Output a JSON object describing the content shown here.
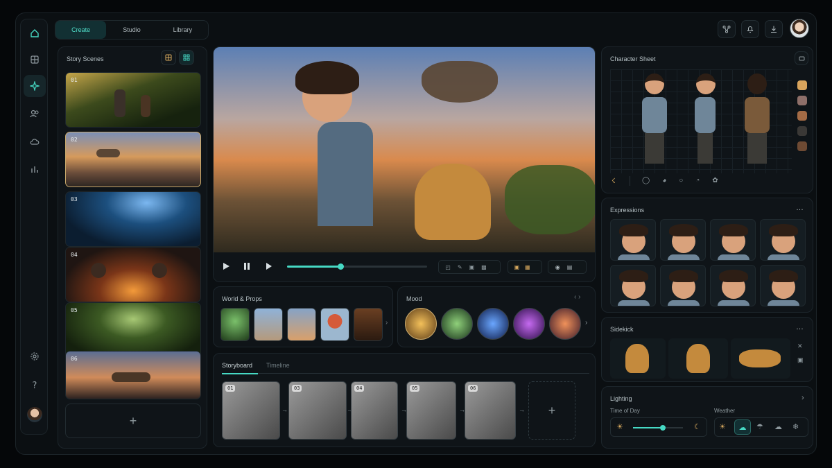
{
  "nav": {
    "tabs": [
      {
        "label": "Create",
        "active": true
      },
      {
        "label": "Studio",
        "active": false
      },
      {
        "label": "Library",
        "active": false
      }
    ],
    "rail_icons": [
      "home-icon",
      "layout-icon",
      "sparkle-icon",
      "users-icon",
      "cloud-icon",
      "chart-icon"
    ],
    "rail_bottom_icons": [
      "settings-icon",
      "help-icon",
      "avatar"
    ],
    "header_icons": [
      "share-icon",
      "bell-icon",
      "download-icon",
      "avatar"
    ]
  },
  "scenes": {
    "title": "Story Scenes",
    "items": [
      {
        "num": "01"
      },
      {
        "num": "02"
      },
      {
        "num": "03"
      },
      {
        "num": "04"
      },
      {
        "num": "05"
      },
      {
        "num": "06"
      }
    ],
    "selected": "02",
    "add_label": "+"
  },
  "player": {
    "progress": 0.38
  },
  "world": {
    "title": "World & Props",
    "items": [
      "forest",
      "castle",
      "airship",
      "balloon",
      "library"
    ]
  },
  "mood": {
    "title": "Mood",
    "items": [
      "golden",
      "green",
      "blue",
      "violet",
      "sunset"
    ]
  },
  "storyboard": {
    "tabs": [
      {
        "label": "Storyboard",
        "active": true
      },
      {
        "label": "Timeline",
        "active": false
      }
    ],
    "frames": [
      {
        "num": "01"
      },
      {
        "num": "03"
      },
      {
        "num": "04"
      },
      {
        "num": "05"
      },
      {
        "num": "06"
      }
    ],
    "add_label": "+"
  },
  "character": {
    "title": "Character Sheet",
    "views": [
      "front",
      "side",
      "back"
    ],
    "swatches": [
      "#d9a45c",
      "#8e6f69",
      "#a46b45",
      "#3a3836",
      "#6e4a33"
    ]
  },
  "expressions": {
    "title": "Expressions",
    "count": 8,
    "more": "…"
  },
  "sidekick": {
    "title": "Sidekick",
    "more": "…",
    "poses": [
      "sitting",
      "standing",
      "walking"
    ]
  },
  "lighting": {
    "title": "Lighting",
    "time_label": "Time of Day",
    "time_value": 0.6,
    "weather_label": "Weather",
    "weather_options": [
      "sunny",
      "cloudy",
      "rainy",
      "stormy",
      "snowy"
    ],
    "weather_selected": "cloudy"
  },
  "colors": {
    "accent": "#46d9c4",
    "highlight": "#c9a96b"
  }
}
